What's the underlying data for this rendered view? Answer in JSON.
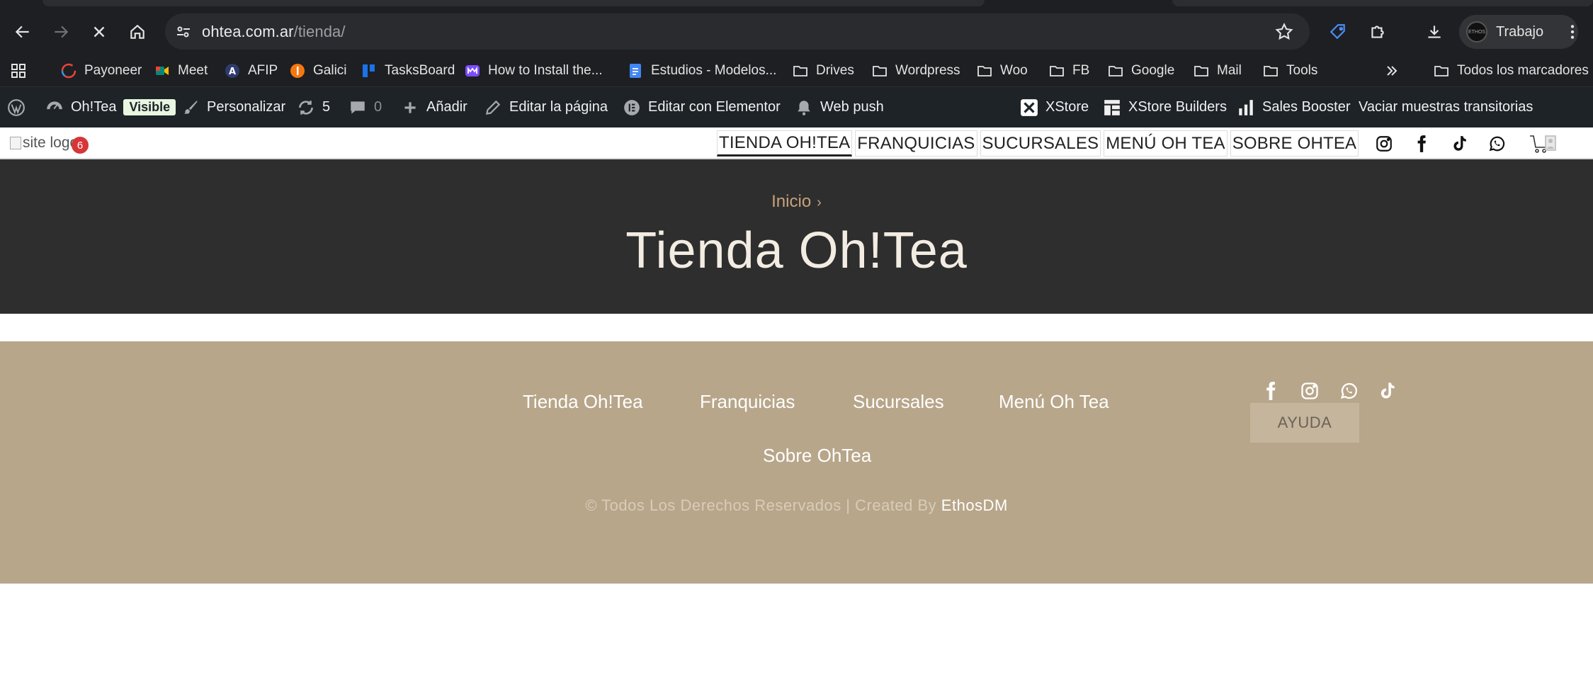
{
  "browser": {
    "url_host": "ohtea.com.ar",
    "url_path": "/tienda/",
    "profile_label": "Trabajo",
    "profile_avatar_text": "ETHOS"
  },
  "bookmarks": [
    {
      "label": "Payoneer",
      "icon": "payoneer-icon"
    },
    {
      "label": "Meet",
      "icon": "meet-icon"
    },
    {
      "label": "AFIP",
      "icon": "afip-icon"
    },
    {
      "label": "Galici",
      "icon": "galicia-icon"
    },
    {
      "label": "TasksBoard",
      "icon": "tasksboard-icon"
    },
    {
      "label": "How to Install the...",
      "icon": "app-icon"
    },
    {
      "label": "Estudios - Modelos...",
      "icon": "docs-icon"
    },
    {
      "label": "Drives",
      "icon": "folder-icon"
    },
    {
      "label": "Wordpress",
      "icon": "folder-icon"
    },
    {
      "label": "Woo",
      "icon": "folder-icon"
    },
    {
      "label": "FB",
      "icon": "folder-icon"
    },
    {
      "label": "Google",
      "icon": "folder-icon"
    },
    {
      "label": "Mail",
      "icon": "folder-icon"
    },
    {
      "label": "Tools",
      "icon": "folder-icon"
    },
    {
      "label": "Todos los marcadores",
      "icon": "folder-icon"
    }
  ],
  "adminbar": {
    "site_name": "Oh!Tea",
    "visible_badge": "Visible",
    "customize": "Personalizar",
    "updates_count": "5",
    "comments_count": "0",
    "add_new": "Añadir",
    "edit_page": "Editar la página",
    "edit_elementor": "Editar con Elementor",
    "web_push": "Web push",
    "xstore": "XStore",
    "xstore_builders": "XStore Builders",
    "sales_booster": "Sales Booster",
    "clear_transients": "Vaciar muestras transitorias"
  },
  "header": {
    "logo_alt": "site logo",
    "notification_count": "6",
    "nav": [
      {
        "label": "TIENDA OH!TEA",
        "active": true
      },
      {
        "label": "FRANQUICIAS",
        "active": false
      },
      {
        "label": "SUCURSALES",
        "active": false
      },
      {
        "label": "MENÚ OH TEA",
        "active": false
      },
      {
        "label": "SOBRE OHTEA",
        "active": false
      }
    ]
  },
  "hero": {
    "breadcrumb": "Inicio",
    "title": "Tienda Oh!Tea"
  },
  "footer": {
    "nav": [
      "Tienda Oh!Tea",
      "Franquicias",
      "Sucursales",
      "Menú Oh Tea",
      "Sobre OhTea"
    ],
    "help_button": "AYUDA",
    "copyright": "© Todos Los Derechos Reservados | Created By ",
    "brand": "EthosDM"
  },
  "colors": {
    "browser_bg": "#1e1f22",
    "adminbar_bg": "#1d2327",
    "hero_bg": "#2e2e2e",
    "footer_bg": "#b8a68a",
    "accent_gold": "#c8a27a"
  }
}
